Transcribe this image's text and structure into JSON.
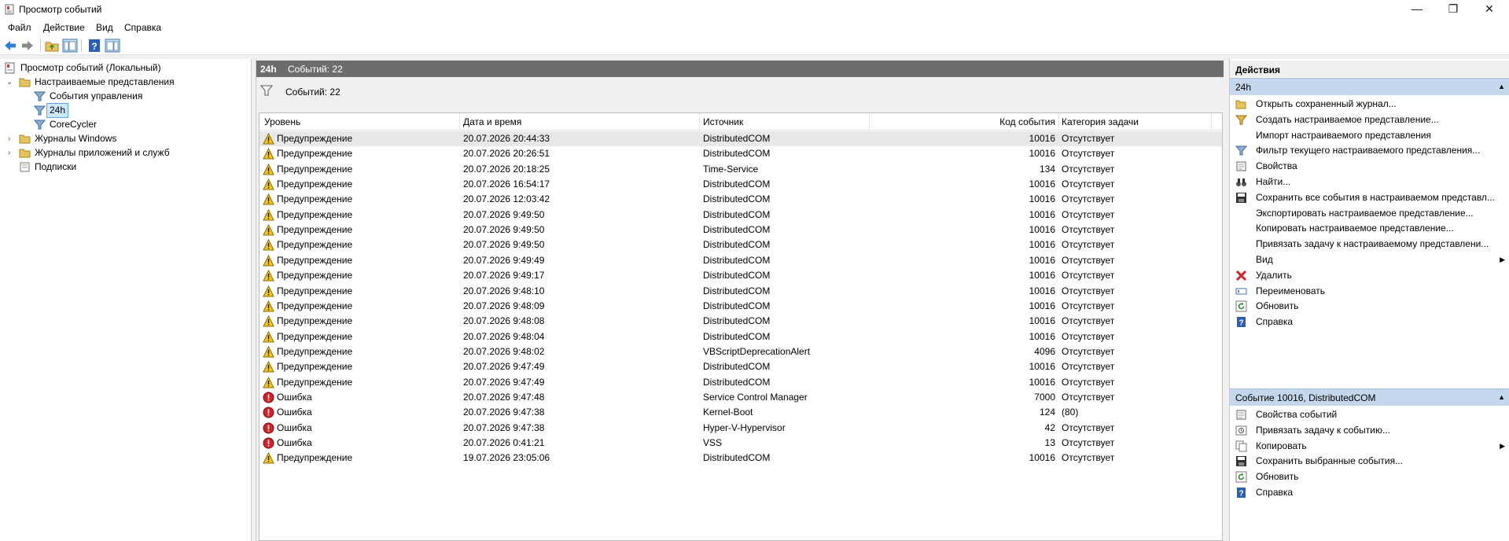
{
  "window": {
    "title": "Просмотр событий",
    "minimize": "—",
    "maximize": "❐",
    "close": "✕"
  },
  "menu": [
    "Файл",
    "Действие",
    "Вид",
    "Справка"
  ],
  "tree": {
    "root": "Просмотр событий (Локальный)",
    "custom_views": "Настраиваемые представления",
    "management_events": "События управления",
    "view_24h": "24h",
    "corecycler": "CoreCycler",
    "windows_logs": "Журналы Windows",
    "app_logs": "Журналы приложений и служб",
    "subscriptions": "Подписки"
  },
  "center": {
    "view_name": "24h",
    "event_count": "Событий: 22",
    "filter_text": "Событий: 22",
    "columns": {
      "level": "Уровень",
      "datetime": "Дата и время",
      "source": "Источник",
      "event_id": "Код события",
      "category": "Категория задачи"
    },
    "rows": [
      {
        "level": "Предупреждение",
        "type": "warning",
        "datetime": "20.07.2026 20:44:33",
        "source": "DistributedCOM",
        "id": "10016",
        "category": "Отсутствует"
      },
      {
        "level": "Предупреждение",
        "type": "warning",
        "datetime": "20.07.2026 20:26:51",
        "source": "DistributedCOM",
        "id": "10016",
        "category": "Отсутствует"
      },
      {
        "level": "Предупреждение",
        "type": "warning",
        "datetime": "20.07.2026 20:18:25",
        "source": "Time-Service",
        "id": "134",
        "category": "Отсутствует"
      },
      {
        "level": "Предупреждение",
        "type": "warning",
        "datetime": "20.07.2026 16:54:17",
        "source": "DistributedCOM",
        "id": "10016",
        "category": "Отсутствует"
      },
      {
        "level": "Предупреждение",
        "type": "warning",
        "datetime": "20.07.2026 12:03:42",
        "source": "DistributedCOM",
        "id": "10016",
        "category": "Отсутствует"
      },
      {
        "level": "Предупреждение",
        "type": "warning",
        "datetime": "20.07.2026 9:49:50",
        "source": "DistributedCOM",
        "id": "10016",
        "category": "Отсутствует"
      },
      {
        "level": "Предупреждение",
        "type": "warning",
        "datetime": "20.07.2026 9:49:50",
        "source": "DistributedCOM",
        "id": "10016",
        "category": "Отсутствует"
      },
      {
        "level": "Предупреждение",
        "type": "warning",
        "datetime": "20.07.2026 9:49:50",
        "source": "DistributedCOM",
        "id": "10016",
        "category": "Отсутствует"
      },
      {
        "level": "Предупреждение",
        "type": "warning",
        "datetime": "20.07.2026 9:49:49",
        "source": "DistributedCOM",
        "id": "10016",
        "category": "Отсутствует"
      },
      {
        "level": "Предупреждение",
        "type": "warning",
        "datetime": "20.07.2026 9:49:17",
        "source": "DistributedCOM",
        "id": "10016",
        "category": "Отсутствует"
      },
      {
        "level": "Предупреждение",
        "type": "warning",
        "datetime": "20.07.2026 9:48:10",
        "source": "DistributedCOM",
        "id": "10016",
        "category": "Отсутствует"
      },
      {
        "level": "Предупреждение",
        "type": "warning",
        "datetime": "20.07.2026 9:48:09",
        "source": "DistributedCOM",
        "id": "10016",
        "category": "Отсутствует"
      },
      {
        "level": "Предупреждение",
        "type": "warning",
        "datetime": "20.07.2026 9:48:08",
        "source": "DistributedCOM",
        "id": "10016",
        "category": "Отсутствует"
      },
      {
        "level": "Предупреждение",
        "type": "warning",
        "datetime": "20.07.2026 9:48:04",
        "source": "DistributedCOM",
        "id": "10016",
        "category": "Отсутствует"
      },
      {
        "level": "Предупреждение",
        "type": "warning",
        "datetime": "20.07.2026 9:48:02",
        "source": "VBScriptDeprecationAlert",
        "id": "4096",
        "category": "Отсутствует"
      },
      {
        "level": "Предупреждение",
        "type": "warning",
        "datetime": "20.07.2026 9:47:49",
        "source": "DistributedCOM",
        "id": "10016",
        "category": "Отсутствует"
      },
      {
        "level": "Предупреждение",
        "type": "warning",
        "datetime": "20.07.2026 9:47:49",
        "source": "DistributedCOM",
        "id": "10016",
        "category": "Отсутствует"
      },
      {
        "level": "Ошибка",
        "type": "error",
        "datetime": "20.07.2026 9:47:48",
        "source": "Service Control Manager",
        "id": "7000",
        "category": "Отсутствует"
      },
      {
        "level": "Ошибка",
        "type": "error",
        "datetime": "20.07.2026 9:47:38",
        "source": "Kernel-Boot",
        "id": "124",
        "category": "(80)"
      },
      {
        "level": "Ошибка",
        "type": "error",
        "datetime": "20.07.2026 9:47:38",
        "source": "Hyper-V-Hypervisor",
        "id": "42",
        "category": "Отсутствует"
      },
      {
        "level": "Ошибка",
        "type": "error",
        "datetime": "20.07.2026 0:41:21",
        "source": "VSS",
        "id": "13",
        "category": "Отсутствует"
      },
      {
        "level": "Предупреждение",
        "type": "warning",
        "datetime": "19.07.2026 23:05:06",
        "source": "DistributedCOM",
        "id": "10016",
        "category": "Отсутствует"
      }
    ]
  },
  "actions": {
    "title": "Действия",
    "section1": "24h",
    "section1_items": [
      {
        "label": "Открыть сохраненный журнал...",
        "icon": "folder-open-icon"
      },
      {
        "label": "Создать настраиваемое представление...",
        "icon": "create-filter-icon"
      },
      {
        "label": "Импорт настраиваемого представления",
        "icon": ""
      },
      {
        "label": "Фильтр текущего настраиваемого представления...",
        "icon": "filter-icon"
      },
      {
        "label": "Свойства",
        "icon": "properties-icon"
      },
      {
        "label": "Найти...",
        "icon": "binoculars-icon"
      },
      {
        "label": "Сохранить все события в настраиваемом представл...",
        "icon": "save-icon"
      },
      {
        "label": "Экспортировать настраиваемое представление...",
        "icon": ""
      },
      {
        "label": "Копировать настраиваемое представление...",
        "icon": ""
      },
      {
        "label": "Привязать задачу к настраиваемому представлени...",
        "icon": ""
      },
      {
        "label": "Вид",
        "icon": "",
        "submenu": true
      },
      {
        "label": "Удалить",
        "icon": "delete-icon"
      },
      {
        "label": "Переименовать",
        "icon": "rename-icon"
      },
      {
        "label": "Обновить",
        "icon": "refresh-icon"
      },
      {
        "label": "Справка",
        "icon": "help-icon"
      }
    ],
    "section2": "Событие 10016, DistributedCOM",
    "section2_items": [
      {
        "label": "Свойства событий",
        "icon": "properties-icon"
      },
      {
        "label": "Привязать задачу к событию...",
        "icon": "task-icon"
      },
      {
        "label": "Копировать",
        "icon": "copy-icon",
        "submenu": true
      },
      {
        "label": "Сохранить выбранные события...",
        "icon": "save-icon"
      },
      {
        "label": "Обновить",
        "icon": "refresh-icon"
      },
      {
        "label": "Справка",
        "icon": "help-icon"
      }
    ]
  }
}
